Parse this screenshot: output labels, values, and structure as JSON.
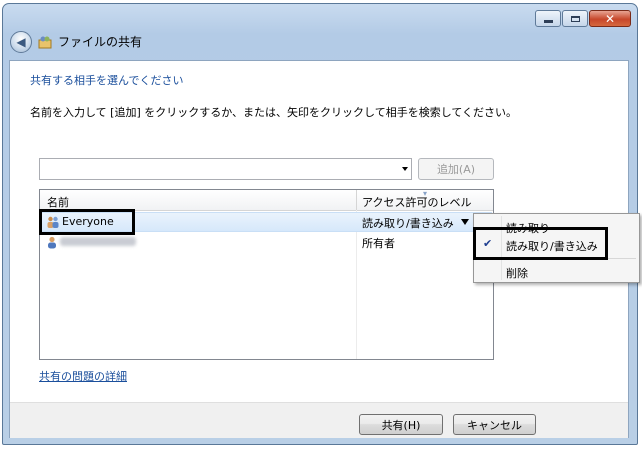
{
  "window": {
    "title": "ファイルの共有",
    "icons": [
      "back-arrow-icon",
      "sharing-icon",
      "minimize-icon",
      "maximize-icon",
      "close-icon"
    ]
  },
  "content": {
    "heading": "共有する相手を選んでください",
    "instruction": "名前を入力して [追加] をクリックするか、または、矢印をクリックして相手を検索してください。",
    "name_input": {
      "value": "",
      "placeholder": ""
    },
    "add_button": "追加(A)"
  },
  "table": {
    "columns": [
      "名前",
      "アクセス許可のレベル"
    ],
    "rows": [
      {
        "name": "Everyone",
        "permission": "読み取り/書き込み",
        "icon": "group-users-icon"
      },
      {
        "name": "",
        "permission": "所有者",
        "icon": "user-icon"
      }
    ]
  },
  "menu": {
    "items": [
      "読み取り",
      "読み取り/書き込み",
      "削除"
    ],
    "checked_index": 1
  },
  "footer": {
    "link": "共有の問題の詳細",
    "share_button": "共有(H)",
    "cancel_button": "キャンセル"
  },
  "colors": {
    "link": "#1b4f9c",
    "highlight_box": "#000000",
    "selected_row": "#d6e8fb"
  }
}
